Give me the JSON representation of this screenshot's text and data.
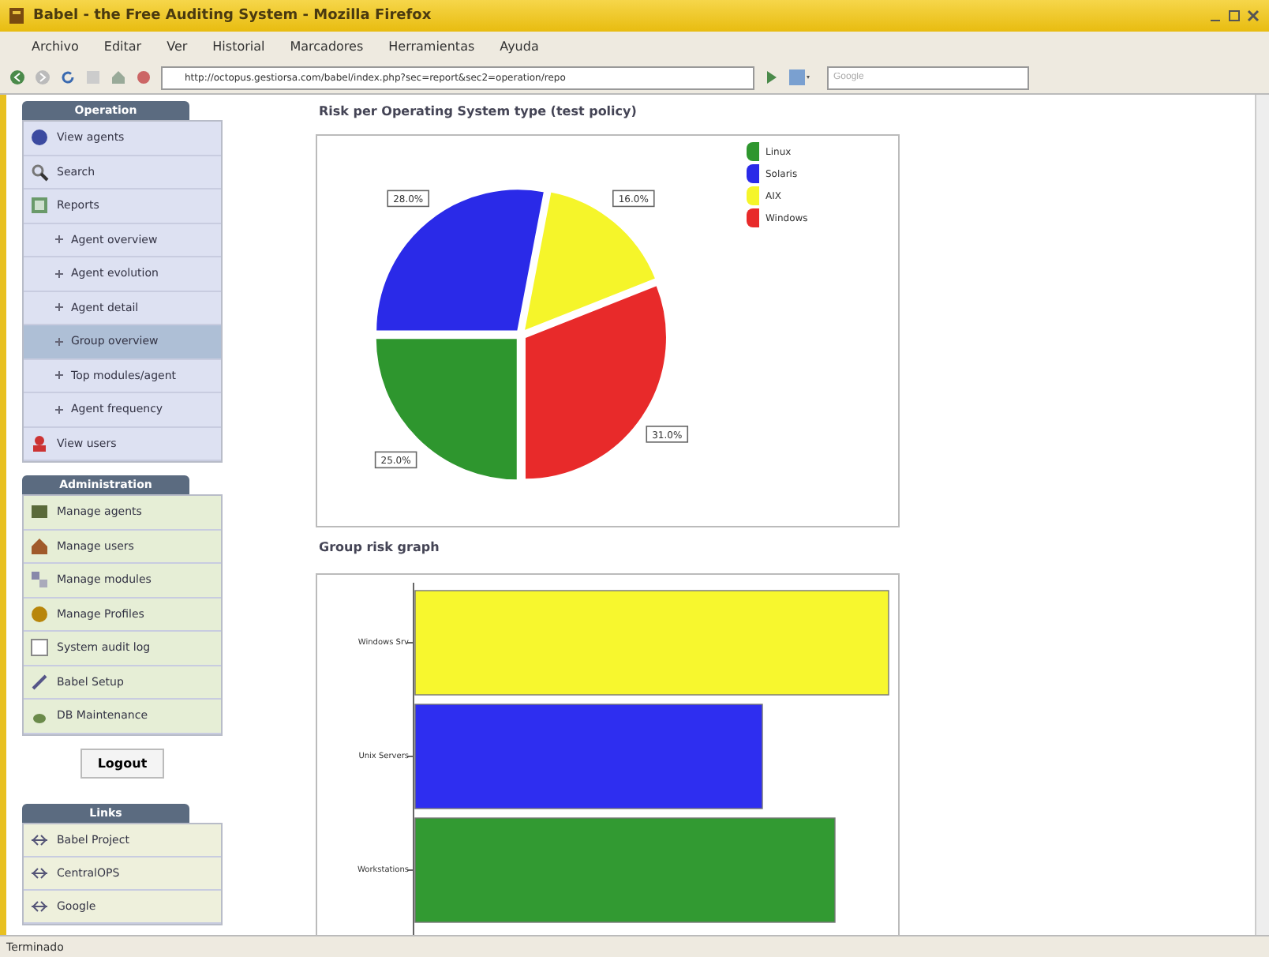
{
  "window": {
    "title": "Babel - the Free Auditing System - Mozilla Firefox"
  },
  "menu": [
    "Archivo",
    "Editar",
    "Ver",
    "Historial",
    "Marcadores",
    "Herramientas",
    "Ayuda"
  ],
  "address_bar": {
    "value": "http://octopus.gestiorsa.com/babel/index.php?sec=report&sec2=operation/repo"
  },
  "search": {
    "placeholder": "Google"
  },
  "sidebar": [
    {
      "title": "Operation",
      "kind": "operation",
      "items": [
        {
          "label": "View agents"
        },
        {
          "label": "Search"
        },
        {
          "label": "Reports",
          "children": [
            {
              "label": "Agent overview",
              "selected": false
            },
            {
              "label": "Agent evolution",
              "selected": false
            },
            {
              "label": "Agent detail",
              "selected": false
            },
            {
              "label": "Group overview",
              "selected": true
            },
            {
              "label": "Top modules/agent",
              "selected": false
            },
            {
              "label": "Agent frequency",
              "selected": false
            }
          ]
        },
        {
          "label": "View users"
        }
      ]
    },
    {
      "title": "Administration",
      "kind": "admin",
      "items": [
        {
          "label": "Manage agents"
        },
        {
          "label": "Manage users"
        },
        {
          "label": "Manage modules"
        },
        {
          "label": "Manage Profiles"
        },
        {
          "label": "System audit log"
        },
        {
          "label": "Babel Setup"
        },
        {
          "label": "DB Maintenance"
        }
      ]
    },
    {
      "title": "Logout",
      "kind": "button"
    },
    {
      "title": "Links",
      "kind": "links",
      "items": [
        {
          "label": "Babel Project"
        },
        {
          "label": "CentralOPS"
        },
        {
          "label": "Google"
        }
      ]
    }
  ],
  "pie_panel": {
    "title": "Risk per Operating System type (test policy)",
    "chart_data": {
      "type": "pie",
      "categories": [
        "Linux",
        "Solaris",
        "AIX",
        "Windows"
      ],
      "values": [
        25,
        28,
        16,
        31
      ],
      "colors": [
        "#2e962e",
        "#2a2ae8",
        "#f5f52a",
        "#e82a2a"
      ],
      "value_labels": [
        "25.0%",
        "28.0%",
        "16.0%",
        "31.0%"
      ],
      "legend": "upper right"
    }
  },
  "bar_panel": {
    "title": "Group risk graph",
    "categories": [
      "Windows Srv",
      "Unix Servers",
      "Workstations"
    ]
  },
  "status_bar": {
    "text": "Terminado"
  }
}
